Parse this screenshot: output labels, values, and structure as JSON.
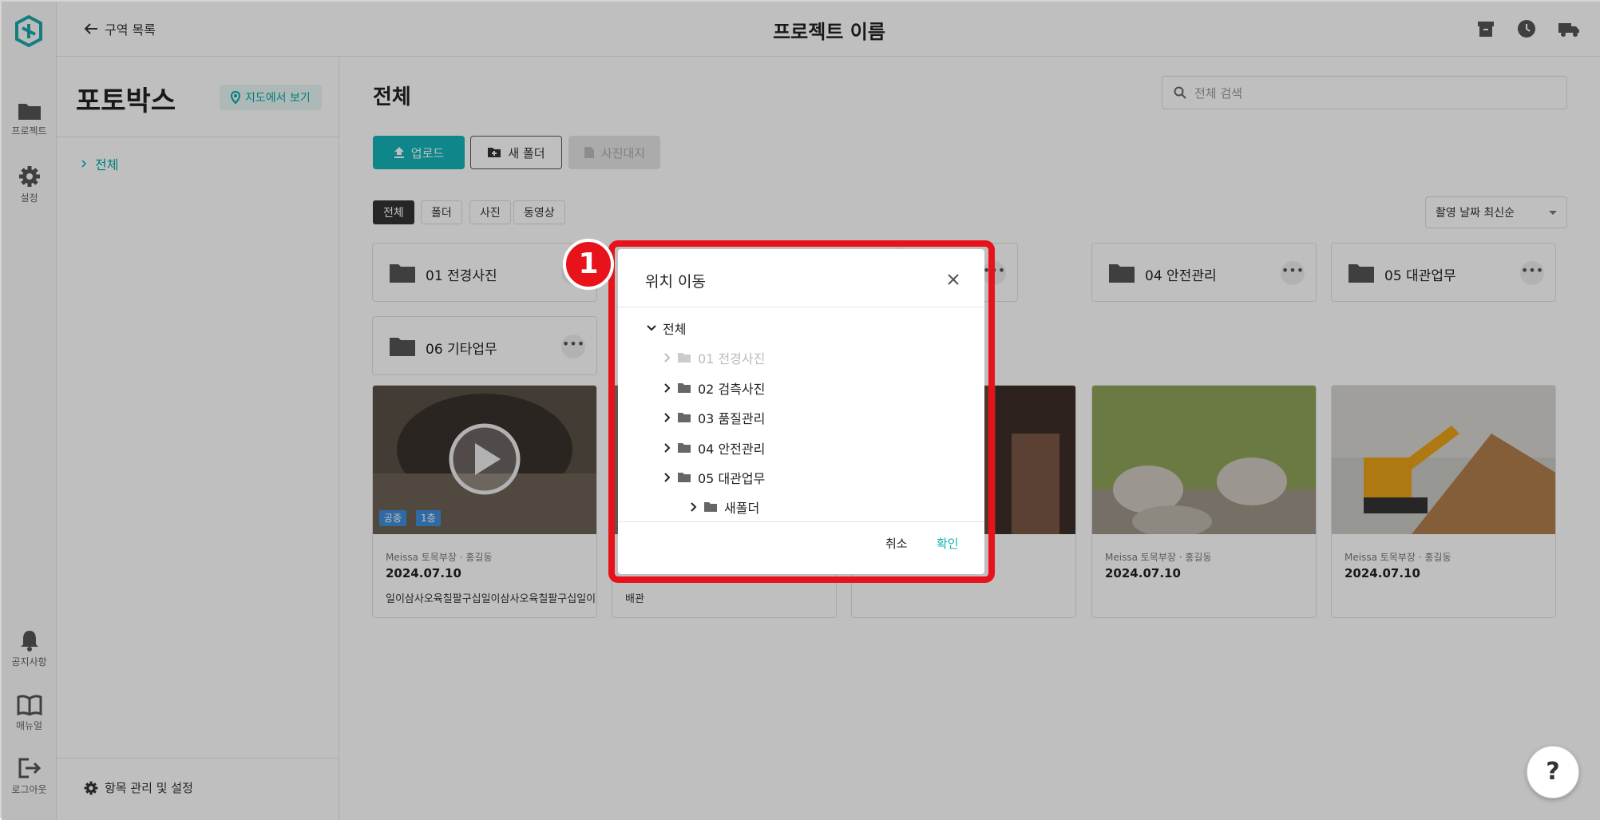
{
  "header": {
    "back_label": "구역 목록",
    "project_title": "프로젝트 이름"
  },
  "rail": {
    "items": [
      {
        "label": "프로젝트",
        "icon": "folder-icon"
      },
      {
        "label": "설정",
        "icon": "gear-icon"
      },
      {
        "label": "공지사항",
        "icon": "bell-icon"
      },
      {
        "label": "매뉴얼",
        "icon": "book-icon"
      },
      {
        "label": "로그아웃",
        "icon": "logout-icon"
      }
    ]
  },
  "side": {
    "title": "포토박스",
    "map_button": "지도에서 보기",
    "tree_root": "전체",
    "manage_label": "항목 관리 및 설정"
  },
  "main": {
    "title": "전체",
    "search_placeholder": "전체 검색",
    "upload_label": "업로드",
    "new_folder_label": "새 폴더",
    "photo_ledger_label": "사진대지",
    "filters": [
      "전체",
      "폴더",
      "사진",
      "동영상"
    ],
    "sort_label": "촬영 날짜 최신순",
    "folders": [
      "01 전경사진",
      "04 안전관리",
      "05 대관업무",
      "06 기타업무"
    ],
    "cards": [
      {
        "meta_a": "Meissa 토목부장",
        "meta_b": "홍길동",
        "date": "2024.07.10",
        "desc": "일이삼사오육칠팔구십일이삼사오육칠팔구십일이...",
        "tags": [
          "공종",
          "1층"
        ]
      },
      {
        "desc": "배관"
      },
      {
        "meta_a": "Meissa 토목부장",
        "meta_b": "홍길동",
        "date": "2024.07.10"
      },
      {
        "meta_a": "Meissa 토목부장",
        "meta_b": "홍길동",
        "date": "2024.07.10"
      }
    ]
  },
  "dialog": {
    "step_number": "1",
    "title": "위치 이동",
    "tree": [
      {
        "label": "전체",
        "level": 0,
        "expanded": true,
        "disabled": false
      },
      {
        "label": "01 전경사진",
        "level": 1,
        "expanded": false,
        "disabled": true
      },
      {
        "label": "02 검측사진",
        "level": 1,
        "expanded": false,
        "disabled": false
      },
      {
        "label": "03 품질관리",
        "level": 1,
        "expanded": false,
        "disabled": false
      },
      {
        "label": "04 안전관리",
        "level": 1,
        "expanded": false,
        "disabled": false
      },
      {
        "label": "05 대관업무",
        "level": 1,
        "expanded": false,
        "disabled": false
      },
      {
        "label": "새폴더",
        "level": 2,
        "expanded": false,
        "disabled": false
      }
    ],
    "cancel_label": "취소",
    "confirm_label": "확인"
  },
  "help_label": "?",
  "colors": {
    "accent": "#14b3b8",
    "highlight": "#e8121b"
  }
}
